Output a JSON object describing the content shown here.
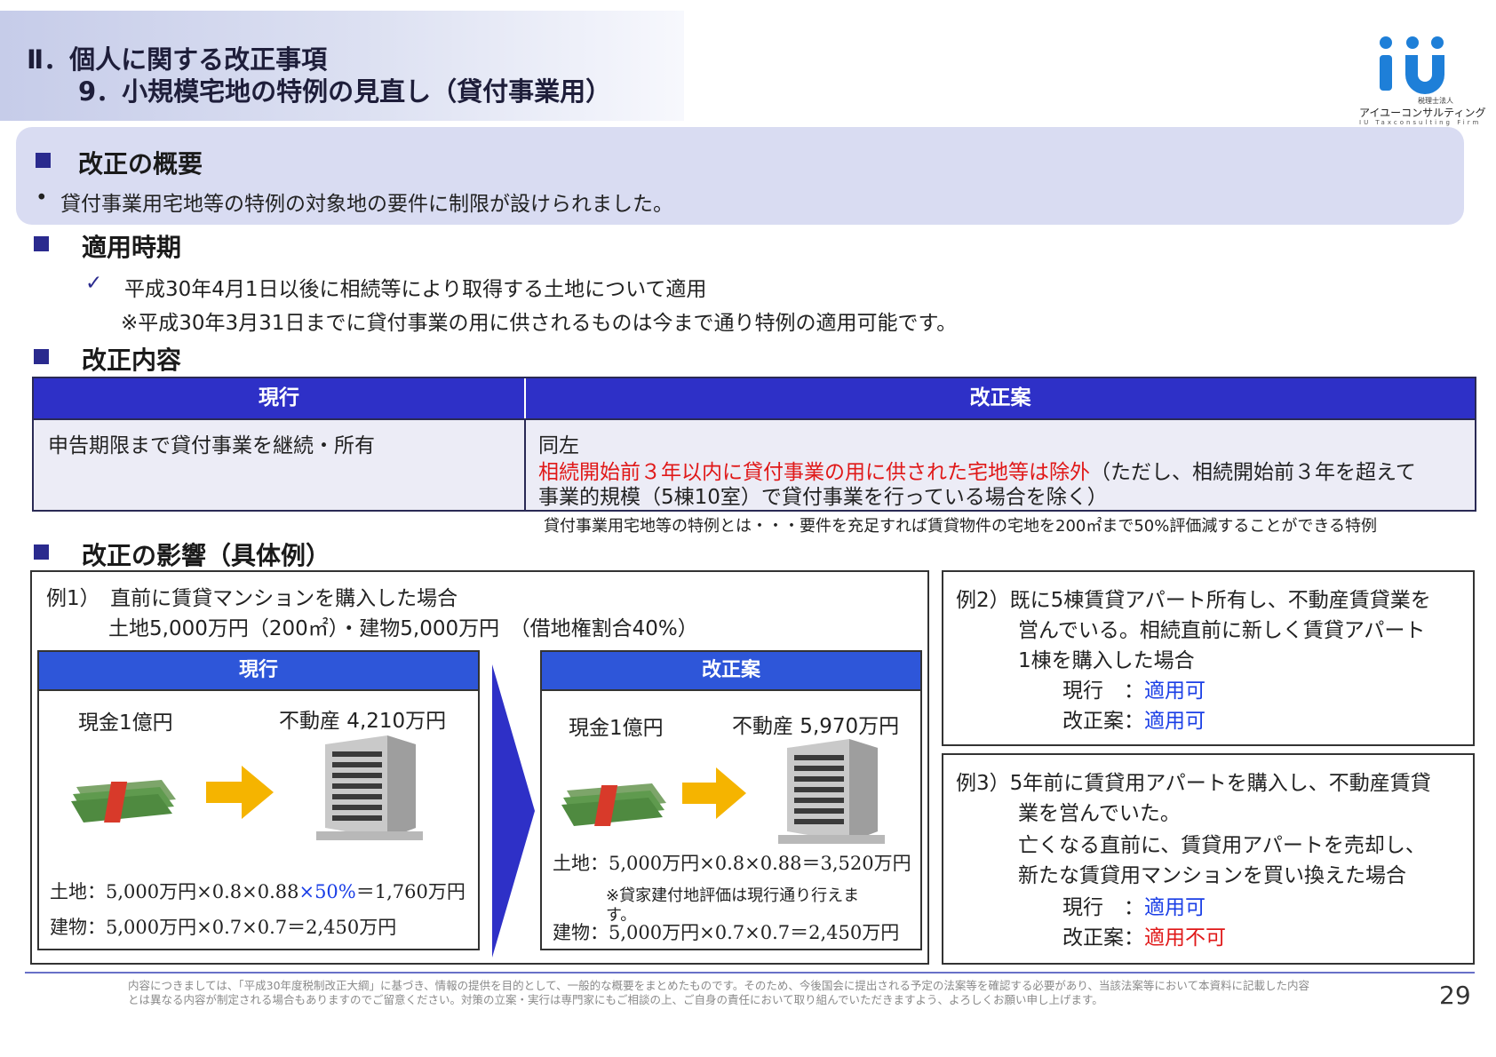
{
  "header": {
    "title_line1": "Ⅱ．個人に関する改正事項",
    "title_line2": "9．小規模宅地の特例の見直し（貸付事業用）"
  },
  "logo": {
    "mark": "iu",
    "name": "アイユーコンサルティング",
    "tag": "税理士法人",
    "sub": "IU Taxconsulting Firm"
  },
  "overview": {
    "heading": "改正の概要",
    "bullet": "貸付事業用宅地等の特例の対象地の要件に制限が設けられました。"
  },
  "timing": {
    "heading": "適用時期",
    "check_text": "平成30年4月1日以後に相続等により取得する土地について適用",
    "note": "※平成30年3月31日までに貸付事業の用に供されるものは今まで通り特例の適用可能です。"
  },
  "content": {
    "heading": "改正内容",
    "col_current": "現行",
    "col_revised": "改正案",
    "current_text": "申告期限まで貸付事業を継続・所有",
    "revised_line1": "同左",
    "revised_red": "相続開始前３年以内に貸付事業の用に供された宅地等は除外",
    "revised_rest": "（ただし、相続開始前３年を超えて",
    "revised_line3": "事業的規模（5棟10室）で貸付事業を行っている場合を除く）",
    "footnote": "貸付事業用宅地等の特例とは・・・要件を充足すれば賃貸物件の宅地を200㎡まで50%評価減することができる特例"
  },
  "impact": {
    "heading": "改正の影響（具体例）",
    "ex1": {
      "title": "例1）　直前に賃貸マンションを購入した場合",
      "sub": "土地5,000万円（200㎡）・建物5,000万円　（借地権割合40%）",
      "current": {
        "label": "現行",
        "cash": "現金1億円",
        "estate": "不動産 4,210万円",
        "land_pre": "土地：5,000万円×0.8×0.88",
        "land_blue": "×50%",
        "land_post": "＝1,760万円",
        "building": "建物：5,000万円×0.7×0.7＝2,450万円"
      },
      "revised": {
        "label": "改正案",
        "cash": "現金1億円",
        "estate": "不動産 5,970万円",
        "land": "土地：5,000万円×0.8×0.88＝3,520万円",
        "note1": "※貸家建付地評価は現行通り行えま",
        "note2": "す。",
        "building": "建物：5,000万円×0.7×0.7＝2,450万円"
      }
    },
    "ex2": {
      "line1": "例2）既に5棟賃貸アパート所有し、不動産賃貸業を",
      "line2": "営んでいる。相続直前に新しく賃貸アパート",
      "line3": "1棟を購入した場合",
      "current_label": "現行　：",
      "current_value": "適用可",
      "revised_label": "改正案：",
      "revised_value": "適用可"
    },
    "ex3": {
      "line1": "例3）5年前に賃貸用アパートを購入し、不動産賃貸",
      "line2": "業を営んでいた。",
      "line3": "亡くなる直前に、賃貸用アパートを売却し、",
      "line4": "新たな賃貸用マンションを買い換えた場合",
      "current_label": "現行　：",
      "current_value": "適用可",
      "revised_label": "改正案：",
      "revised_value": "適用不可"
    }
  },
  "footer": {
    "disclaimer1": "内容につきましては、「平成30年度税制改正大綱」に基づき、情報の提供を目的として、一般的な概要をまとめたものです。そのため、今後国会に提出される予定の法案等を確認する必要があり、当該法案等において本資料に記載した内容",
    "disclaimer2": "とは異なる内容が制定される場合もありますのでご留意ください。対策の立案・実行は専門家にもご相談の上、ご自身の責任において取り組んでいただきますよう、よろしくお願い申し上げます。",
    "page": "29"
  },
  "colors": {
    "navy": "#2a2a8e",
    "table_head": "#2e30c7",
    "red": "#e01818",
    "blue": "#1a3ee6",
    "arrow": "#f5b400"
  }
}
